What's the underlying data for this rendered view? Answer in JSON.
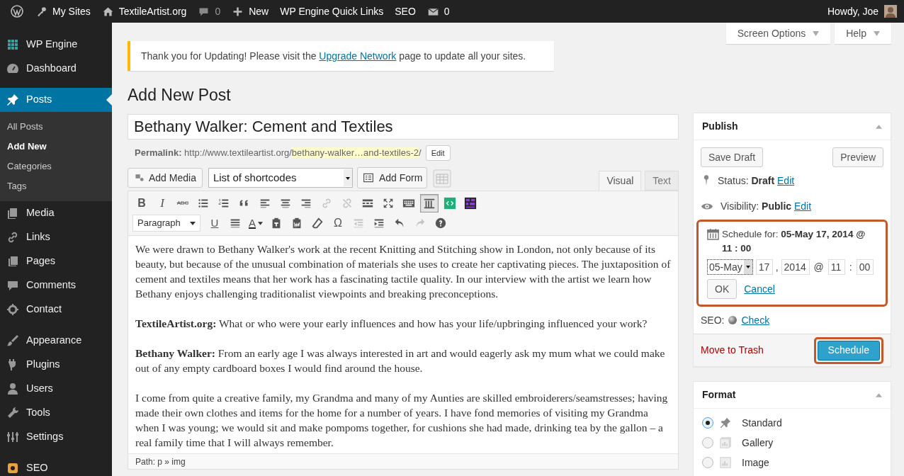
{
  "admin_bar": {
    "items": [
      {
        "kind": "wp-logo"
      },
      {
        "kind": "sites",
        "label": "My Sites"
      },
      {
        "kind": "home",
        "label": "TextileArtist.org"
      },
      {
        "kind": "comments",
        "label": "0"
      },
      {
        "kind": "new",
        "label": "New"
      },
      {
        "kind": "text",
        "label": "WP Engine Quick Links"
      },
      {
        "kind": "text",
        "label": "SEO"
      },
      {
        "kind": "mail",
        "label": "0"
      }
    ],
    "account": {
      "label": "Howdy, Joe"
    }
  },
  "sidebar": {
    "sections": [
      {
        "items": [
          {
            "kind": "grid",
            "label": "WP Engine",
            "selected": false
          },
          {
            "kind": "dashboard",
            "label": "Dashboard",
            "selected": false
          }
        ]
      },
      {
        "items": [
          {
            "kind": "pin",
            "label": "Posts",
            "selected": true,
            "children": [
              {
                "label": "All Posts",
                "selected": false
              },
              {
                "label": "Add New",
                "selected": true
              },
              {
                "label": "Categories",
                "selected": false
              },
              {
                "label": "Tags",
                "selected": false
              }
            ]
          },
          {
            "kind": "media",
            "label": "Media",
            "selected": false
          },
          {
            "kind": "link",
            "label": "Links",
            "selected": false
          },
          {
            "kind": "pages",
            "label": "Pages",
            "selected": false
          },
          {
            "kind": "comments",
            "label": "Comments",
            "selected": false
          },
          {
            "kind": "gear",
            "label": "Contact",
            "selected": false
          }
        ]
      },
      {
        "items": [
          {
            "kind": "brush",
            "label": "Appearance",
            "selected": false
          },
          {
            "kind": "plug",
            "label": "Plugins",
            "selected": false
          },
          {
            "kind": "user",
            "label": "Users",
            "selected": false
          },
          {
            "kind": "wrench",
            "label": "Tools",
            "selected": false
          },
          {
            "kind": "settings",
            "label": "Settings",
            "selected": false
          }
        ]
      },
      {
        "items": [
          {
            "kind": "seo",
            "label": "SEO",
            "selected": false
          }
        ]
      }
    ]
  },
  "screen_meta": [
    {
      "label": "Screen Options"
    },
    {
      "label": "Help"
    }
  ],
  "notice": {
    "text": "Thank you for Updating! Please visit the ",
    "link": "Upgrade Network",
    "after": " page to update all your sites."
  },
  "page_title": "Add New Post",
  "post_title": {
    "value": "Bethany Walker: Cement and Textiles"
  },
  "permalink": {
    "label": "Permalink:",
    "base": "http://www.textileartist.org/",
    "slug": "bethany-walker…and-textiles-2",
    "suffix": "/",
    "button": "Edit"
  },
  "media_buttons": {
    "add_media": "Add Media",
    "shortcodes": "List of shortcodes",
    "add_form": "Add Form"
  },
  "editor_tabs": [
    {
      "label": "Visual",
      "selected": true
    },
    {
      "label": "Text",
      "selected": false
    }
  ],
  "toolbar": {
    "rows": [
      {
        "buttons": [
          {
            "kind": "bold",
            "glyph": "B"
          },
          {
            "kind": "italic",
            "glyph": "I"
          },
          {
            "kind": "strike",
            "glyph": "ABC"
          },
          {
            "kind": "bullets"
          },
          {
            "kind": "numbers"
          },
          {
            "kind": "quote"
          },
          {
            "kind": "align-left"
          },
          {
            "kind": "align-center"
          },
          {
            "kind": "align-right"
          },
          {
            "kind": "link",
            "disabled": true
          },
          {
            "kind": "unlink",
            "disabled": true
          },
          {
            "kind": "more"
          },
          {
            "kind": "fullscreen"
          },
          {
            "kind": "keyboard"
          },
          {
            "kind": "columns",
            "active": true
          },
          {
            "kind": "code"
          },
          {
            "kind": "grid"
          }
        ]
      },
      {
        "buttons": [
          {
            "kind": "format",
            "value": "Paragraph"
          },
          {
            "kind": "underline",
            "glyph": "U"
          },
          {
            "kind": "justify"
          },
          {
            "kind": "color",
            "glyph": "A"
          },
          {
            "kind": "paste-text"
          },
          {
            "kind": "paste-word"
          },
          {
            "kind": "eraser"
          },
          {
            "kind": "char",
            "glyph": "Ω"
          },
          {
            "kind": "outdent",
            "disabled": true
          },
          {
            "kind": "indent"
          },
          {
            "kind": "undo"
          },
          {
            "kind": "redo",
            "disabled": true
          },
          {
            "kind": "help"
          }
        ]
      }
    ]
  },
  "content": [
    "We were drawn to Bethany Walker's work at the recent Knitting and Stitching show in London, not only because of its beauty, but because of the unusual combination of materials she uses to create her captivating pieces. The juxtaposition of cement and textiles means that her work has a fascinating tactile quality. In our interview with the artist we learn how Bethany enjoys challenging traditionalist viewpoints and breaking preconceptions.",
    "**TextileArtist.org:** What or who were your early influences and how has your life/upbringing influenced your work?",
    "**Bethany Walker:** From an early age I was always interested in art and would eagerly ask my mum what we could make out of any empty cardboard boxes I would find around the house.",
    "I come from quite a creative family, my Grandma and many of my Aunties are skilled embroiderers/seamstresses; having made their own clothes and items for the home for a number of years. I have fond memories of visiting my Grandma when I was young; we would sit and make pompoms together, for cushions she had made, drinking tea by the gallon – a real family time that I will always remember."
  ],
  "path": "Path: p » img",
  "publish": {
    "title": "Publish",
    "save_draft": "Save Draft",
    "preview": "Preview",
    "status": {
      "label": "Status:",
      "value": "Draft",
      "link": "Edit"
    },
    "visibility": {
      "label": "Visibility:",
      "value": "Public",
      "link": "Edit"
    },
    "schedule": {
      "highlighted": true,
      "label": "Schedule for:",
      "value": "05-May 17, 2014 @ 11 : 00",
      "month": "05-May",
      "day": "17",
      "comma": ",",
      "year": "2014",
      "at": "@",
      "hour": "11",
      "colon": ":",
      "minute": "00",
      "ok": "OK",
      "cancel": "Cancel"
    },
    "seo": {
      "label": "SEO:",
      "link": "Check"
    },
    "trash": "Move to Trash",
    "submit": {
      "label": "Schedule",
      "highlighted": true
    }
  },
  "format": {
    "title": "Format",
    "options": [
      {
        "kind": "standard",
        "label": "Standard",
        "selected": true
      },
      {
        "kind": "gallery",
        "label": "Gallery",
        "selected": false
      },
      {
        "kind": "image",
        "label": "Image",
        "selected": false
      }
    ]
  }
}
